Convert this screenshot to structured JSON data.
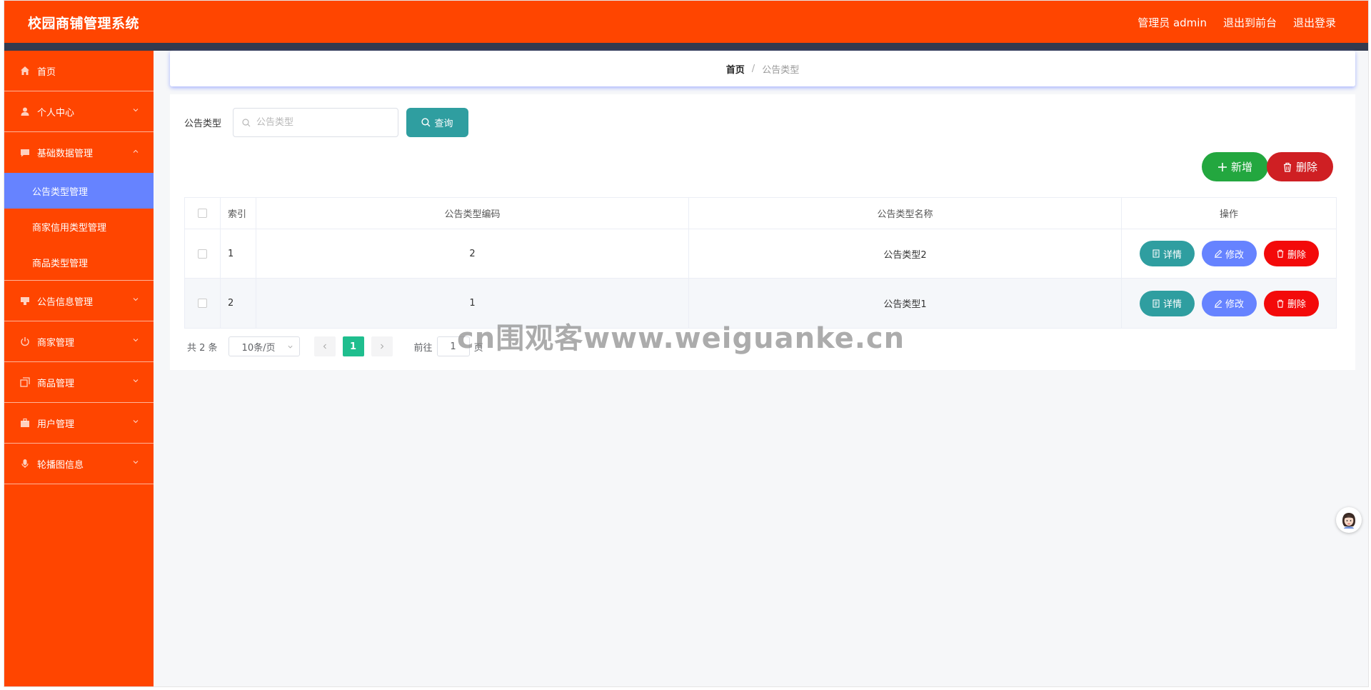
{
  "app": {
    "title": "校园商铺管理系统",
    "header_links": [
      "管理员 admin",
      "退出到前台",
      "退出登录"
    ]
  },
  "sidebar": {
    "items": [
      {
        "label": "首页",
        "icon": "home-icon"
      },
      {
        "label": "个人中心",
        "icon": "user-icon"
      },
      {
        "label": "基础数据管理",
        "icon": "chat-icon"
      },
      {
        "label": "公告类型管理"
      },
      {
        "label": "商家信用类型管理"
      },
      {
        "label": "商品类型管理"
      },
      {
        "label": "公告信息管理",
        "icon": "chart-icon"
      },
      {
        "label": "商家管理",
        "icon": "power-icon"
      },
      {
        "label": "商品管理",
        "icon": "copy-icon"
      },
      {
        "label": "用户管理",
        "icon": "briefcase-icon"
      },
      {
        "label": "轮播图信息",
        "icon": "mic-icon"
      }
    ]
  },
  "breadcrumb": {
    "home": "首页",
    "separator": "/",
    "current": "公告类型"
  },
  "search": {
    "label": "公告类型",
    "placeholder": "公告类型",
    "button": "查询"
  },
  "actions": {
    "add": "新增",
    "delete": "删除"
  },
  "table": {
    "headers": [
      "索引",
      "公告类型编码",
      "公告类型名称",
      "操作"
    ],
    "rows": [
      {
        "index": "1",
        "code": "2",
        "name": "公告类型2"
      },
      {
        "index": "2",
        "code": "1",
        "name": "公告类型1"
      }
    ],
    "row_actions": {
      "detail": "详情",
      "edit": "修改",
      "delete": "删除"
    }
  },
  "pagination": {
    "total": "共 2 条",
    "page_size": "10条/页",
    "current_page": "1",
    "goto_prefix": "前往",
    "goto_value": "1",
    "goto_suffix": "页"
  },
  "watermark": "cn围观客www.weiguanke.cn",
  "colors": {
    "primary": "#ff4500",
    "strip": "#333a4e",
    "active_sub": "#6683ff",
    "query": "#2f9ea0",
    "add": "#23a73f",
    "delete": "#cf1f23",
    "row_delete": "#f30a0a",
    "page_active": "#1fbe8e"
  }
}
